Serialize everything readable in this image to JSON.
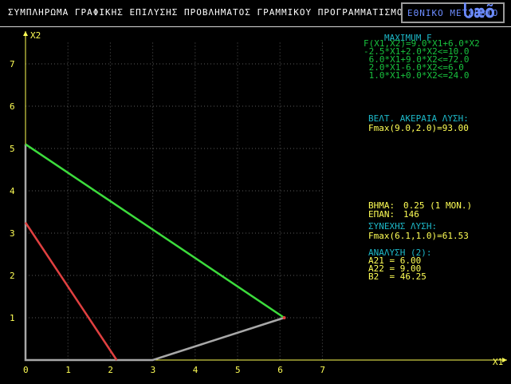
{
  "header": {
    "title": "ΣΥΜΠΛΗΡΩΜΑ ΓΡΑΦΙΚΗΣ ΕΠΙΛΥΣΗΣ ΠΡΟΒΛΗΜΑΤΟΣ ΓΡΑΜΜΙΚΟΥ ΠΡΟΓΡΑΜΜΑΤΙΣΜΟΥ",
    "brand_text": "ΕΘΝΙΚΟ ΜΕΤΣΟΒΙΟ",
    "brand_glyph": "Ⴑæõ"
  },
  "chart_data": {
    "type": "line",
    "xlabel": "X1",
    "ylabel": "X2",
    "x_ticks": [
      "0",
      "1",
      "2",
      "3",
      "4",
      "5",
      "6",
      "7"
    ],
    "y_ticks": [
      "1",
      "2",
      "3",
      "4",
      "5",
      "6",
      "7"
    ],
    "xlim": [
      0,
      7
    ],
    "ylim": [
      0,
      7
    ],
    "grid": true,
    "series": [
      {
        "color": "#3cdc3c",
        "points": [
          [
            0,
            5.1
          ],
          [
            6.1,
            1.0
          ]
        ]
      },
      {
        "color": "#e04040",
        "points": [
          [
            0,
            3.25
          ],
          [
            2.15,
            0
          ]
        ]
      },
      {
        "color": "#a8a8a8",
        "points": [
          [
            0,
            0
          ],
          [
            0,
            5.0
          ],
          [
            0,
            5.1
          ],
          [
            0,
            0
          ],
          [
            3.0,
            0
          ],
          [
            6.1,
            1.0
          ]
        ]
      }
    ],
    "point": {
      "x": 6.1,
      "y": 1.0,
      "color": "#e04040"
    }
  },
  "panel": {
    "max_title": "MAXIMUM F",
    "objective": "F(X1,X2)=9.0*X1+6.0*X2",
    "constraints": [
      "-2.5*X1+2.0*X2<=10.0",
      " 6.0*X1+9.0*X2<=72.0",
      " 2.0*X1-6.0*X2<=6.0",
      " 1.0*X1+0.0*X2<=24.0"
    ],
    "opt_title": "ΒΕΛΤ. ΑΚΕΡΑΙΑ ΛΥΣΗ:",
    "opt_value": "Fmax(9.0,2.0)=93.00",
    "step_label": "ΒΗΜΑ:",
    "step_value": "0.25 (1 ΜΟΝ.)",
    "iter_label": "ΕΠΑΝ:",
    "iter_value": "146",
    "cont_title": "ΣΥΝΕΧΗΣ ΛΥΣΗ:",
    "cont_value": "Fmax(6.1,1.0)=61.53",
    "sens_title": "ΑΝΑΛΥΣΗ (2):",
    "sens_lines": [
      "A21 = 6.00",
      "A22 = 9.00",
      "B2  = 46.25"
    ]
  }
}
